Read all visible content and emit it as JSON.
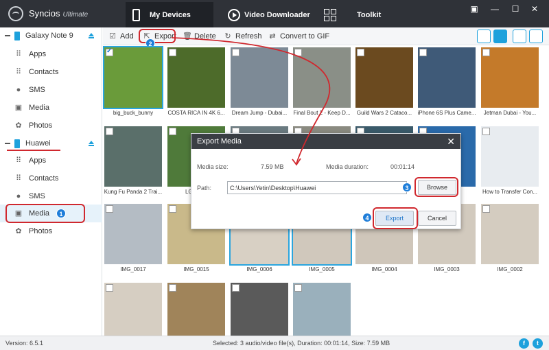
{
  "app": {
    "name": "Syncios",
    "edition": "Ultimate"
  },
  "nav": {
    "my_devices": "My Devices",
    "video_downloader": "Video Downloader",
    "toolkit": "Toolkit"
  },
  "window_controls": [
    "▣",
    "—",
    "☐",
    "✕"
  ],
  "sidebar": {
    "device1": {
      "name": "Galaxy Note 9",
      "items": [
        "Apps",
        "Contacts",
        "SMS",
        "Media",
        "Photos"
      ]
    },
    "device2": {
      "name": "Huawei",
      "items": [
        "Apps",
        "Contacts",
        "SMS",
        "Media",
        "Photos"
      ],
      "active": "Media"
    }
  },
  "toolbar": {
    "add": "Add",
    "export": "Export",
    "delete": "Delete",
    "refresh": "Refresh",
    "convert": "Convert to GIF"
  },
  "tiles": [
    {
      "label": "big_buck_bunny",
      "color": "#6a9b3a",
      "checked": true
    },
    {
      "label": "COSTA RICA IN 4K 6...",
      "color": "#4d6b2a",
      "checked": false
    },
    {
      "label": "Dream Jump - Dubai...",
      "color": "#7d8a96",
      "checked": false
    },
    {
      "label": "Final Bout 2 - Keep D...",
      "color": "#8a8f87",
      "checked": false
    },
    {
      "label": "Guild Wars 2 Cataco...",
      "color": "#6b4a1f",
      "checked": false
    },
    {
      "label": "iPhone 6S Plus Came...",
      "color": "#3f5a78",
      "checked": false
    },
    {
      "label": "Jetman Dubai  - You...",
      "color": "#c47a2a",
      "checked": false
    },
    {
      "label": "Kung Fu Panda 2 Trai...",
      "color": "#5a6f6a",
      "checked": false
    },
    {
      "label": "LG Ciner",
      "color": "#4f7a3a",
      "checked": false
    },
    {
      "label": "",
      "color": "#6a7a80",
      "checked": false
    },
    {
      "label": "",
      "color": "#8a8a80",
      "checked": false
    },
    {
      "label": "",
      "color": "#3a5a6a",
      "checked": false
    },
    {
      "label": "",
      "color": "#2a6aaa",
      "checked": false
    },
    {
      "label": "How to Transfer Con...",
      "color": "#e8ecf0",
      "checked": false
    },
    {
      "label": "IMG_0017",
      "color": "#b4bcc4",
      "checked": false
    },
    {
      "label": "IMG_0015",
      "color": "#c9b98a",
      "checked": false
    },
    {
      "label": "IMG_0006",
      "color": "#d8d0c4",
      "checked": true
    },
    {
      "label": "IMG_0005",
      "color": "#d0c8bc",
      "checked": true
    },
    {
      "label": "IMG_0004",
      "color": "#cfc6ba",
      "checked": false
    },
    {
      "label": "IMG_0003",
      "color": "#d2cabe",
      "checked": false
    },
    {
      "label": "IMG_0002",
      "color": "#d4ccc0",
      "checked": false
    },
    {
      "label": "",
      "color": "#d6cec2",
      "checked": false
    },
    {
      "label": "",
      "color": "#a0845a",
      "checked": false
    },
    {
      "label": "",
      "color": "#5a5a5a",
      "checked": false
    },
    {
      "label": "",
      "color": "#9ab0bc",
      "checked": false
    }
  ],
  "dialog": {
    "title": "Export Media",
    "media_size_label": "Media size:",
    "media_size_value": "7.59 MB",
    "media_duration_label": "Media duration:",
    "media_duration_value": "00:01:14",
    "path_label": "Path:",
    "path_value": "C:\\Users\\Yetin\\Desktop\\Huawei",
    "browse": "Browse",
    "export": "Export",
    "cancel": "Cancel"
  },
  "annotations": {
    "step1": "1",
    "step2": "2",
    "step3": "3",
    "step4": "4"
  },
  "status": {
    "version": "Version: 6.5.1",
    "info": "Selected: 3 audio/video file(s), Duration: 00:01:14, Size: 7.59 MB"
  },
  "social": {
    "facebook": "f",
    "twitter": "t"
  },
  "colors": {
    "accent": "#1da1dc",
    "annotation_red": "#d0282e",
    "badge_blue": "#1f7ed9",
    "titlebar": "#2f3238"
  }
}
